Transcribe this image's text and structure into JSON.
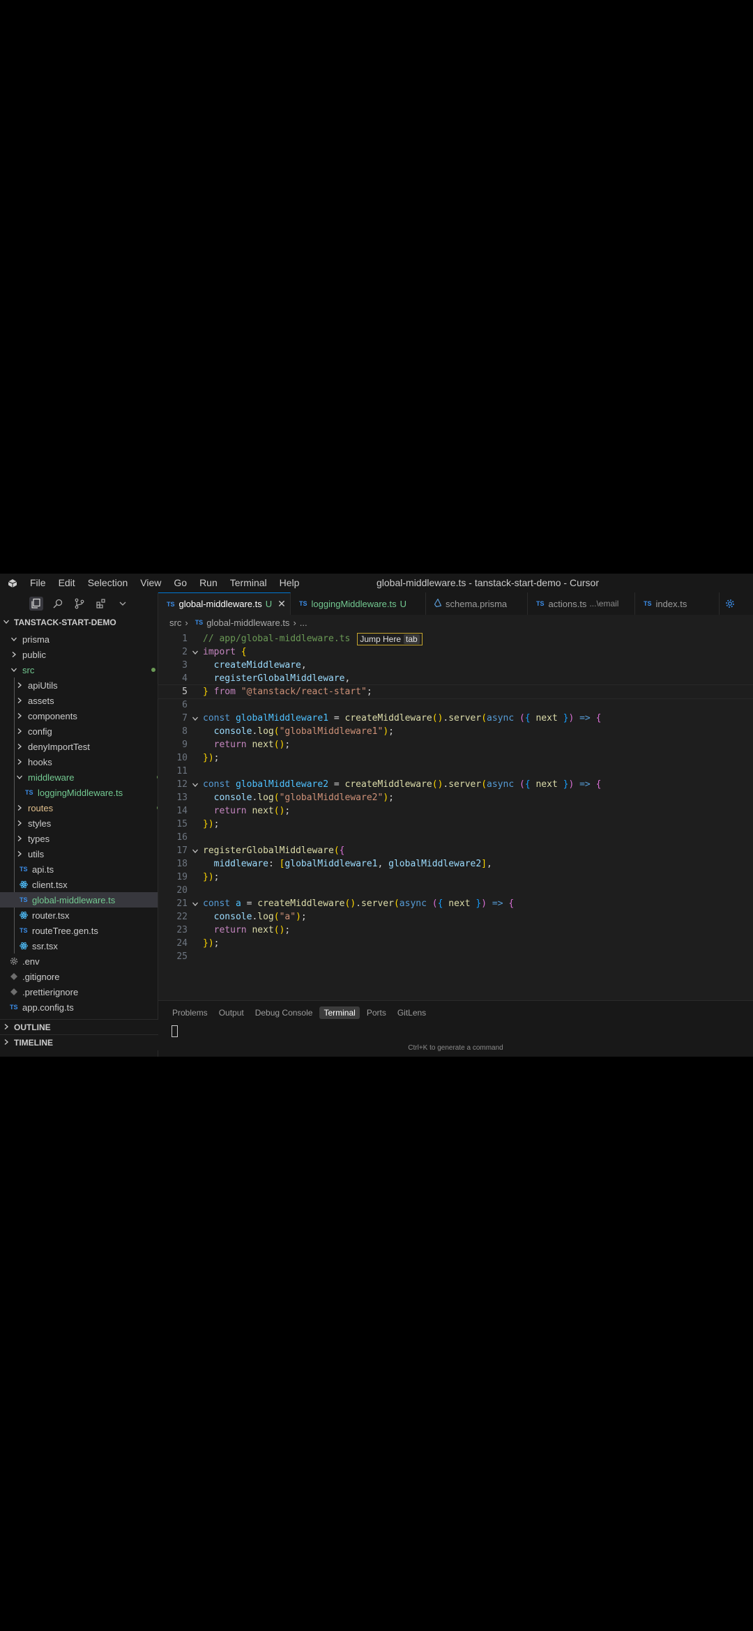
{
  "titlebar": {
    "menu": [
      "File",
      "Edit",
      "Selection",
      "View",
      "Go",
      "Run",
      "Terminal",
      "Help"
    ],
    "window_title": "global-middleware.ts - tanstack-start-demo - Cursor"
  },
  "explorer": {
    "project": "TANSTACK-START-DEMO",
    "items": [
      {
        "label": "prisma",
        "kind": "folder",
        "open": true,
        "depth": 0
      },
      {
        "label": "public",
        "kind": "folder",
        "open": false,
        "depth": 0
      },
      {
        "label": "src",
        "kind": "folder",
        "open": true,
        "depth": 0,
        "status": "dot"
      },
      {
        "label": "apiUtils",
        "kind": "folder",
        "open": false,
        "depth": 1
      },
      {
        "label": "assets",
        "kind": "folder",
        "open": false,
        "depth": 1
      },
      {
        "label": "components",
        "kind": "folder",
        "open": false,
        "depth": 1
      },
      {
        "label": "config",
        "kind": "folder",
        "open": false,
        "depth": 1
      },
      {
        "label": "denyImportTest",
        "kind": "folder",
        "open": false,
        "depth": 1
      },
      {
        "label": "hooks",
        "kind": "folder",
        "open": false,
        "depth": 1
      },
      {
        "label": "middleware",
        "kind": "folder",
        "open": true,
        "depth": 1,
        "status": "dot"
      },
      {
        "label": "loggingMiddleware.ts",
        "kind": "ts",
        "depth": 2,
        "status": "U"
      },
      {
        "label": "routes",
        "kind": "folder",
        "open": false,
        "depth": 1,
        "status": "dot"
      },
      {
        "label": "styles",
        "kind": "folder",
        "open": false,
        "depth": 1
      },
      {
        "label": "types",
        "kind": "folder",
        "open": false,
        "depth": 1
      },
      {
        "label": "utils",
        "kind": "folder",
        "open": false,
        "depth": 1
      },
      {
        "label": "api.ts",
        "kind": "ts",
        "depth": 1
      },
      {
        "label": "client.tsx",
        "kind": "react",
        "depth": 1
      },
      {
        "label": "global-middleware.ts",
        "kind": "ts",
        "depth": 1,
        "status": "U",
        "selected": true
      },
      {
        "label": "router.tsx",
        "kind": "react",
        "depth": 1
      },
      {
        "label": "routeTree.gen.ts",
        "kind": "ts",
        "depth": 1
      },
      {
        "label": "ssr.tsx",
        "kind": "react",
        "depth": 1
      },
      {
        "label": ".env",
        "kind": "gear",
        "depth": 0
      },
      {
        "label": ".gitignore",
        "kind": "diamond",
        "depth": 0
      },
      {
        "label": ".prettierignore",
        "kind": "diamond",
        "depth": 0
      },
      {
        "label": "app.config.ts",
        "kind": "ts",
        "depth": 0
      }
    ],
    "outline": "OUTLINE",
    "timeline": "TIMELINE"
  },
  "tabs": [
    {
      "label": "global-middleware.ts",
      "badge": "U",
      "icon": "TS",
      "active": true
    },
    {
      "label": "loggingMiddleware.ts",
      "badge": "U",
      "icon": "TS",
      "active": false
    },
    {
      "label": "schema.prisma",
      "badge": "",
      "icon": "prisma",
      "active": false
    },
    {
      "label": "actions.ts",
      "desc": "...\\email",
      "icon": "TS",
      "active": false
    },
    {
      "label": "index.ts",
      "badge": "",
      "icon": "TS",
      "active": false
    }
  ],
  "breadcrumb": {
    "folder": "src",
    "file": "global-middleware.ts",
    "rest": "..."
  },
  "inline_hint": {
    "label": "Jump Here",
    "key": "tab"
  },
  "code_lines": [
    "// app/global-middleware.ts",
    "import {",
    "  createMiddleware,",
    "  registerGlobalMiddleware,",
    "} from \"@tanstack/react-start\";",
    "",
    "const globalMiddleware1 = createMiddleware().server(async ({ next }) => {",
    "  console.log(\"globalMiddleware1\");",
    "  return next();",
    "});",
    "",
    "const globalMiddleware2 = createMiddleware().server(async ({ next }) => {",
    "  console.log(\"globalMiddleware2\");",
    "  return next();",
    "});",
    "",
    "registerGlobalMiddleware({",
    "  middleware: [globalMiddleware1, globalMiddleware2],",
    "});",
    "",
    "const a = createMiddleware().server(async ({ next }) => {",
    "  console.log(\"a\");",
    "  return next();",
    "});",
    ""
  ],
  "current_line": 5,
  "panel": {
    "tabs": [
      "Problems",
      "Output",
      "Debug Console",
      "Terminal",
      "Ports",
      "GitLens"
    ],
    "active_tab": "Terminal",
    "hint": "Ctrl+K to generate a command"
  }
}
